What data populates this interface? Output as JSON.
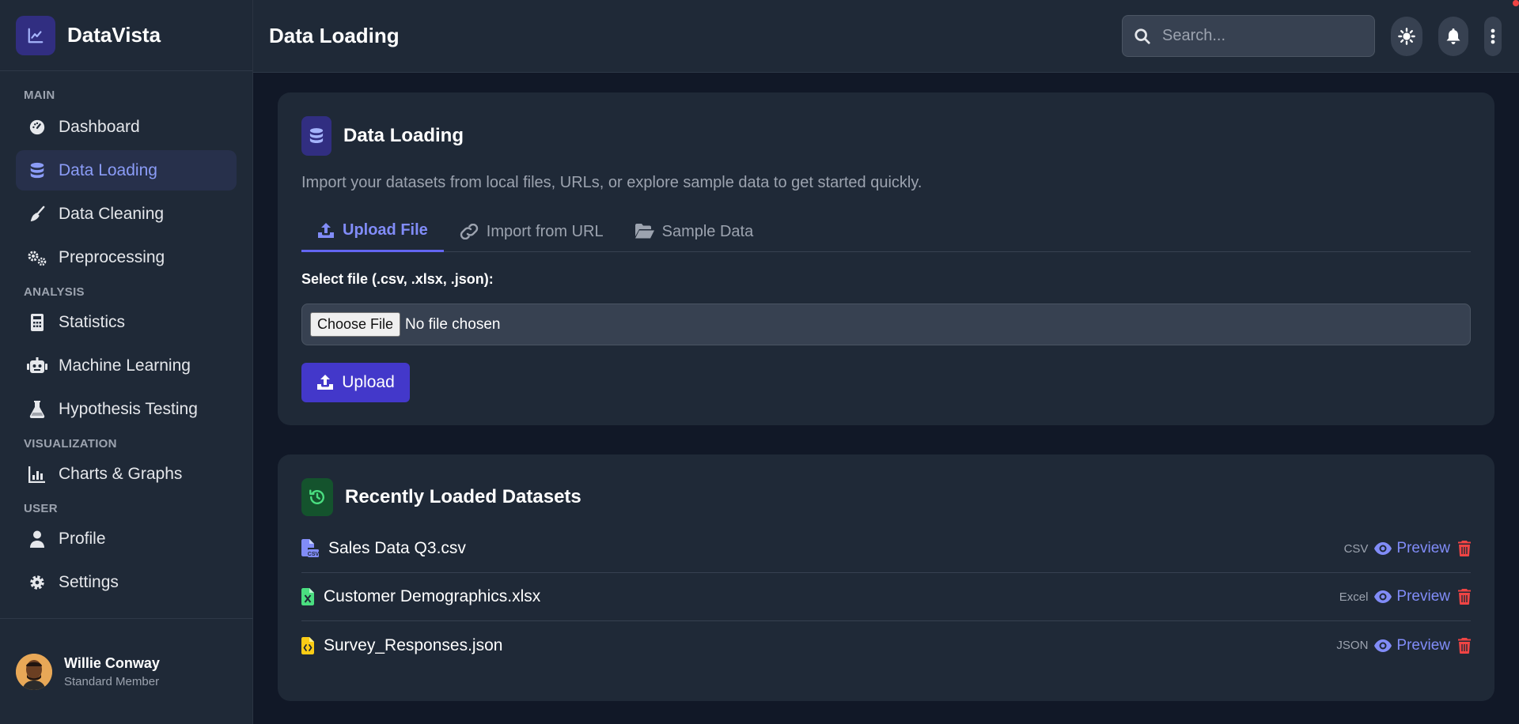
{
  "brand": {
    "name": "DataVista"
  },
  "sidebar": {
    "sections": [
      {
        "label": "MAIN",
        "items": [
          {
            "label": "Dashboard",
            "icon": "gauge-icon"
          },
          {
            "label": "Data Loading",
            "icon": "database-icon",
            "active": true
          },
          {
            "label": "Data Cleaning",
            "icon": "broom-icon"
          },
          {
            "label": "Preprocessing",
            "icon": "cogs-icon"
          }
        ]
      },
      {
        "label": "ANALYSIS",
        "items": [
          {
            "label": "Statistics",
            "icon": "calculator-icon"
          },
          {
            "label": "Machine Learning",
            "icon": "robot-icon"
          },
          {
            "label": "Hypothesis Testing",
            "icon": "flask-icon"
          }
        ]
      },
      {
        "label": "VISUALIZATION",
        "items": [
          {
            "label": "Charts & Graphs",
            "icon": "chart-bar-icon"
          }
        ]
      },
      {
        "label": "USER",
        "items": [
          {
            "label": "Profile",
            "icon": "user-icon"
          },
          {
            "label": "Settings",
            "icon": "gear-icon"
          }
        ]
      }
    ],
    "user": {
      "name": "Willie Conway",
      "role": "Standard Member"
    }
  },
  "header": {
    "title": "Data Loading",
    "search_placeholder": "Search..."
  },
  "loading_card": {
    "title": "Data Loading",
    "description": "Import your datasets from local files, URLs, or explore sample data to get started quickly.",
    "tabs": [
      {
        "label": "Upload File",
        "active": true
      },
      {
        "label": "Import from URL"
      },
      {
        "label": "Sample Data"
      }
    ],
    "file_label": "Select file (.csv, .xlsx, .json):",
    "choose_button": "Choose File",
    "no_file": "No file chosen",
    "upload_button": "Upload"
  },
  "recent_card": {
    "title": "Recently Loaded Datasets",
    "preview_label": "Preview",
    "datasets": [
      {
        "name": "Sales Data Q3.csv",
        "type": "CSV",
        "color": "#818cf8"
      },
      {
        "name": "Customer Demographics.xlsx",
        "type": "Excel",
        "color": "#4ade80"
      },
      {
        "name": "Survey_Responses.json",
        "type": "JSON",
        "color": "#facc15"
      }
    ]
  },
  "colors": {
    "accent": "#6366f1",
    "danger": "#ef4444",
    "sidebar_bg": "#1f2937",
    "page_bg": "#111827"
  }
}
